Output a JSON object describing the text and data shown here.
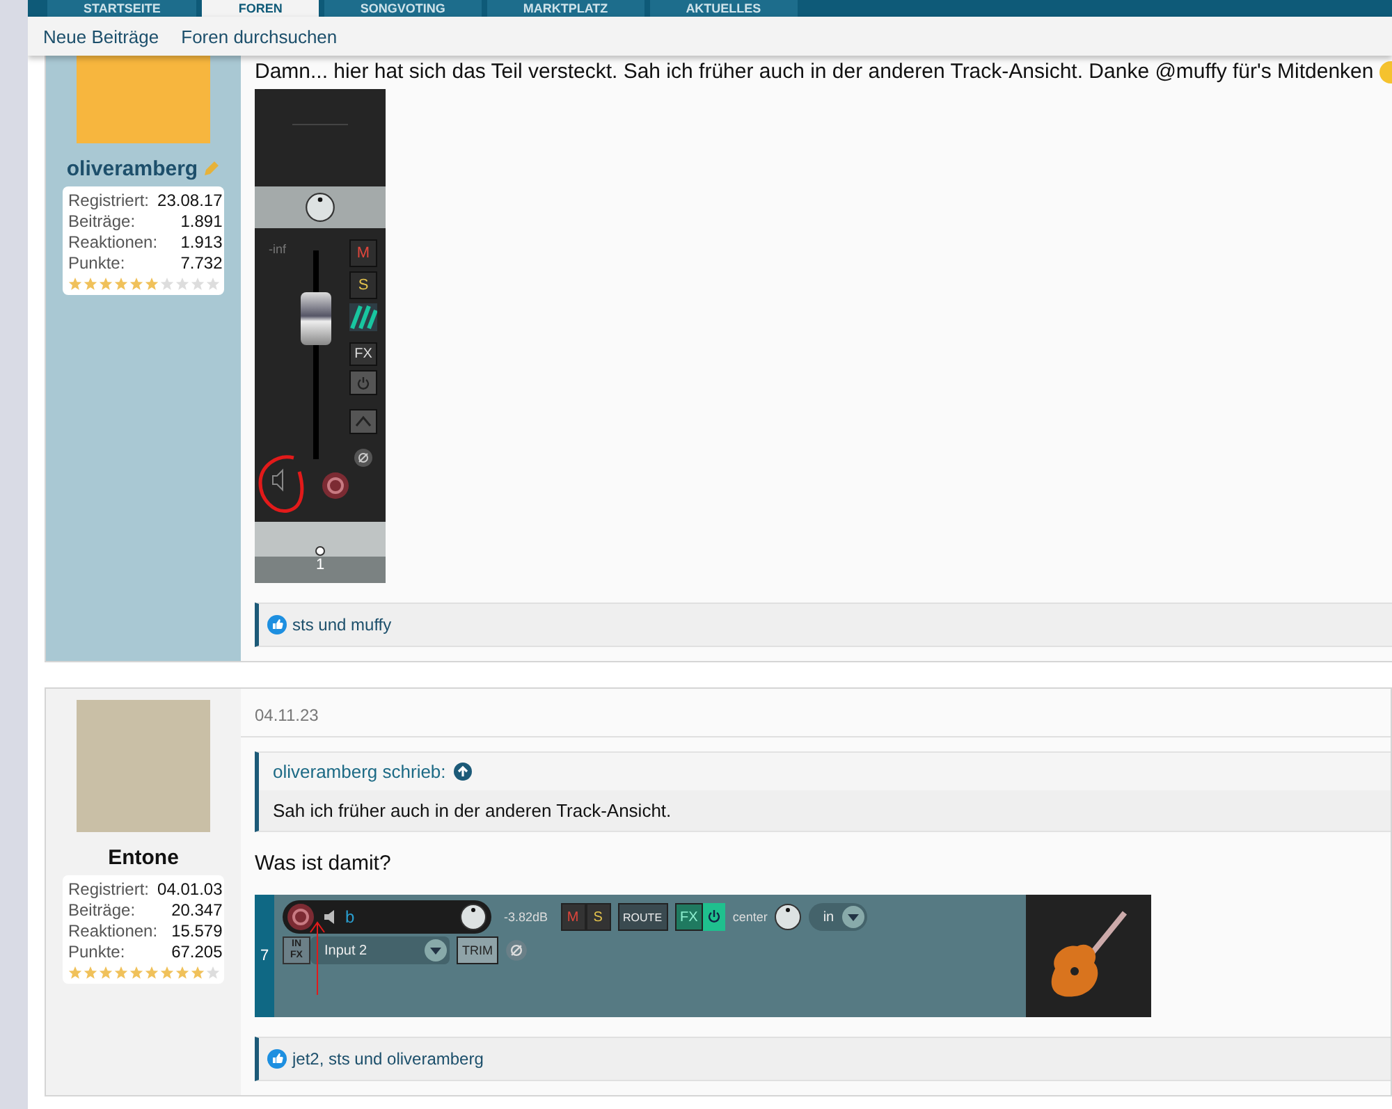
{
  "nav": {
    "tabs": [
      {
        "label": "STARTSEITE",
        "selected": false
      },
      {
        "label": "FOREN",
        "selected": true
      },
      {
        "label": "SONGVOTING",
        "selected": false
      },
      {
        "label": "MARKTPLATZ",
        "selected": false
      },
      {
        "label": "AKTUELLES",
        "selected": false
      }
    ],
    "subnav": [
      "Neue Beiträge",
      "Foren durchsuchen"
    ]
  },
  "posts": [
    {
      "user": {
        "name": "oliveramberg",
        "stats": [
          {
            "label": "Registriert:",
            "value": "23.08.17"
          },
          {
            "label": "Beiträge:",
            "value": "1.891"
          },
          {
            "label": "Reaktionen:",
            "value": "1.913"
          },
          {
            "label": "Punkte:",
            "value": "7.732"
          }
        ],
        "stars": 6
      },
      "text": "Damn... hier hat sich das Teil versteckt. Sah ich früher auch in der anderen Track-Ansicht. Danke @muffy für's Mitdenken",
      "attachment": {
        "kind": "mixer",
        "volume": "-inf",
        "mute": "M",
        "solo": "S",
        "fx": "FX",
        "track_number": "1"
      },
      "reactions": "sts und muffy"
    },
    {
      "user": {
        "name": "Entone",
        "stats": [
          {
            "label": "Registriert:",
            "value": "04.01.03"
          },
          {
            "label": "Beiträge:",
            "value": "20.347"
          },
          {
            "label": "Reaktionen:",
            "value": "15.579"
          },
          {
            "label": "Punkte:",
            "value": "67.205"
          }
        ],
        "stars": 9
      },
      "date": "04.11.23",
      "quote": {
        "author": "oliveramberg schrieb:",
        "text": "Sah ich früher auch in der anderen Track-Ansicht."
      },
      "text": "Was ist damit?",
      "attachment": {
        "kind": "track",
        "track_number": "7",
        "name": "b",
        "volume": "-3.82dB",
        "mute": "M",
        "solo": "S",
        "route": "ROUTE",
        "fx": "FX",
        "pan": "center",
        "mode": "in",
        "in_fx": [
          "IN",
          "FX"
        ],
        "input": "Input 2",
        "trim": "TRIM"
      },
      "reactions": "jet2, sts und oliveramberg"
    }
  ]
}
